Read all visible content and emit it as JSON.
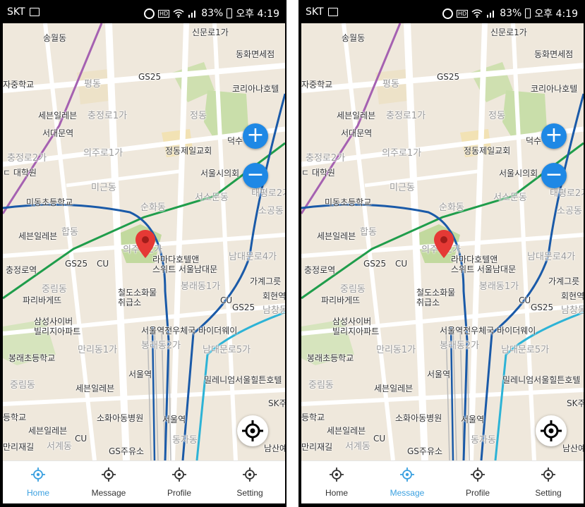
{
  "statusbar": {
    "carrier": "SKT",
    "battery": "83%",
    "time": "오후 4:19",
    "hd_badge": "HD"
  },
  "colors": {
    "accent": "#3aa0e0",
    "zoom_button": "#1e88e5",
    "pin": "#e53935",
    "map_bg": "#efe8dc"
  },
  "map": {
    "zoom_in_symbol": "+",
    "zoom_out_symbol": "−",
    "labels": {
      "songwoldong": "송월동",
      "sinmunro1ga": "신문로1가",
      "donghwa": "동화면세점",
      "gs25_a": "GS25",
      "jungschool": "자중학교",
      "pyeongdong": "평동",
      "korea_hotel": "코리아나호텔",
      "severance_a": "세븐일레븐",
      "chungjeongro1ga": "충정로1가",
      "jeongdong": "정동",
      "seodaemun": "서대문역",
      "deoksu": "덕수",
      "chungjeongro2ga": "충정로2가",
      "uijuro1ga": "의주로1가",
      "jeongdong_church": "정동제일교회",
      "graduate": "ㄷ 대학원",
      "cityhall": "서울시의회",
      "migeundong": "미근동",
      "seosomun": "서소문동",
      "taepyeong": "태평로2가",
      "midong_school": "미동초등학교",
      "sunhwadong": "순화동",
      "sogong": "소공동",
      "severance_b": "세븐일레븐",
      "hapdong": "합동",
      "uijuro2ga": "의주로2가",
      "namdaemunro4ga": "남대문로4가",
      "chungjeongro_stn": "충정로역",
      "gs25_b": "GS25",
      "cu_a": "CU",
      "ramada": "라마다호텔앤\n스위트 서울남대문",
      "jungnimdong": "중림동",
      "bongnae1ga": "봉래동1가",
      "gagye": "가계그릇",
      "paris": "파리바게뜨",
      "cheoldo": "철도소화물\n취급소",
      "cu_b": "CU",
      "hoehyeon": "회현역",
      "gs25_c": "GS25",
      "namchang": "남창동",
      "samsung": "삼성사이버\n빌리지아파트",
      "seoulstn_way": "서울역전우체국 바이더웨이",
      "manri1ga": "만리동1가",
      "bongnae2ga": "봉래동2가",
      "namdaemunro5ga": "남대문로5가",
      "bongnae_school": "봉래초등학교",
      "seoul_stn_a": "서울역",
      "millennium": "밀레니엄서울힐튼호텔",
      "jungnimdong2": "중림동",
      "severance_c": "세븐일레븐",
      "sk": "SK주",
      "deung_school": "등학교",
      "sowha_hosp": "소화아동병원",
      "seoul_stn_b": "서울역",
      "severance_d": "세븐일레븐",
      "cu_c": "CU",
      "dongja": "동자동",
      "manrijae": "만리재길",
      "seogye": "서계동",
      "gs_oil": "GS주유소",
      "namsan": "남산예"
    }
  },
  "tabs": [
    {
      "label": "Home"
    },
    {
      "label": "Message"
    },
    {
      "label": "Profile"
    },
    {
      "label": "Setting"
    }
  ],
  "screens": [
    {
      "active_tab": "Home"
    },
    {
      "active_tab": "Message"
    }
  ]
}
